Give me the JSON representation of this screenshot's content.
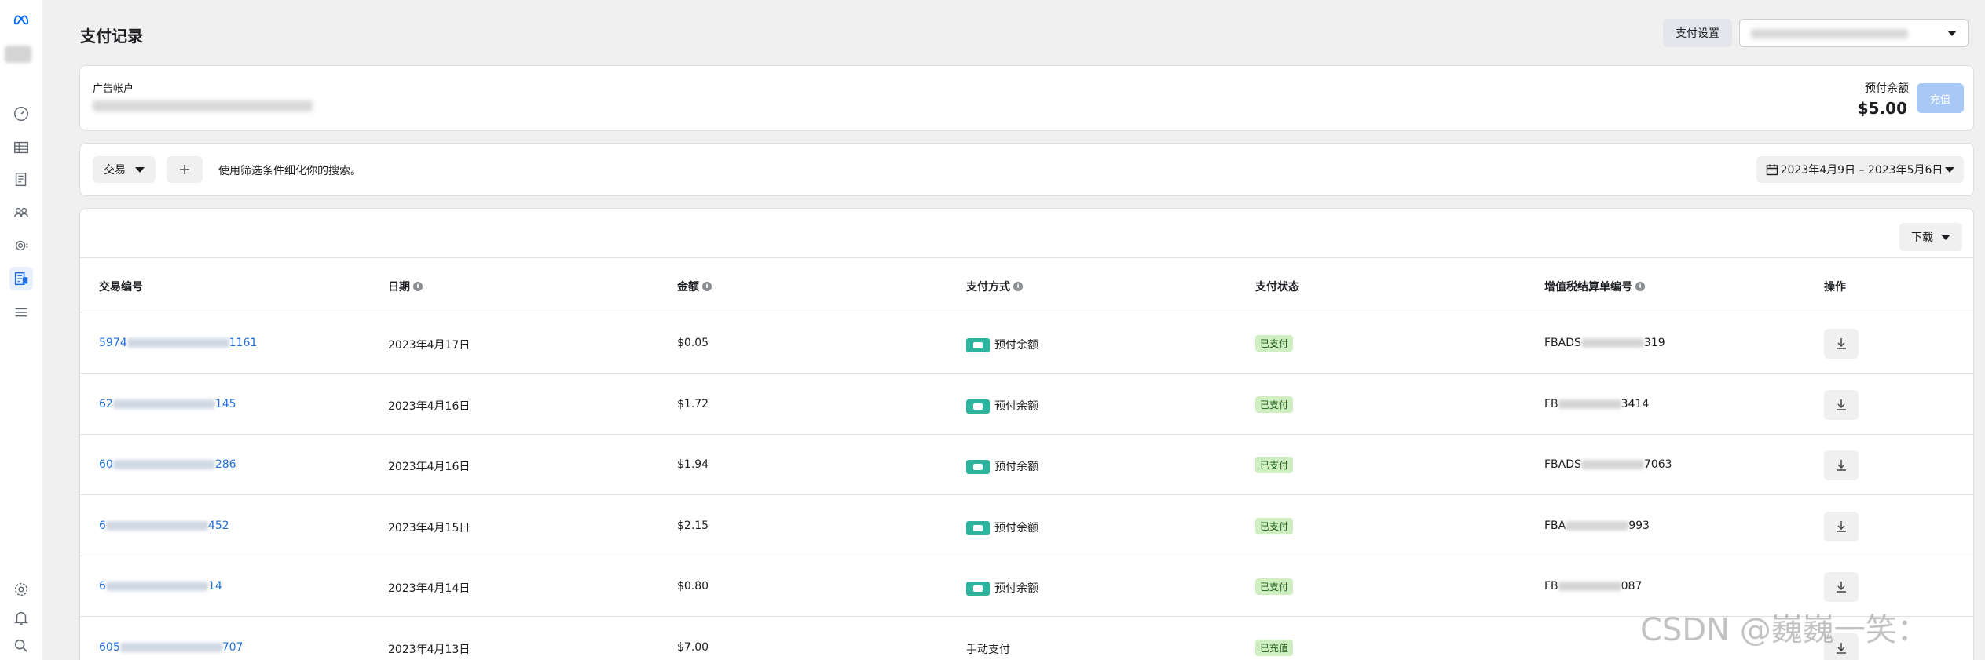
{
  "header": {
    "title": "支付记录",
    "payment_settings_label": "支付设置"
  },
  "account_card": {
    "label": "广告帐户",
    "balance_label": "预付余额",
    "balance_value": "$5.00",
    "topup_label": "充值"
  },
  "filter_bar": {
    "filter_label": "交易",
    "add_icon": "plus-icon",
    "hint": "使用筛选条件细化你的搜索。",
    "date_range": "2023年4月9日 – 2023年5月6日"
  },
  "table": {
    "download_label": "下载",
    "columns": [
      "交易编号",
      "日期",
      "金额",
      "支付方式",
      "支付状态",
      "增值税结算单编号",
      "操作"
    ],
    "rows": [
      {
        "id_prefix": "5974",
        "id_suffix": "1161",
        "date": "2023年4月17日",
        "amount": "$0.05",
        "method": "预付余额",
        "status": "已支付",
        "vat_prefix": "FBADS",
        "vat_suffix": "319"
      },
      {
        "id_prefix": "62",
        "id_suffix": "145",
        "date": "2023年4月16日",
        "amount": "$1.72",
        "method": "预付余额",
        "status": "已支付",
        "vat_prefix": "FB",
        "vat_suffix": "3414"
      },
      {
        "id_prefix": "60",
        "id_suffix": "286",
        "date": "2023年4月16日",
        "amount": "$1.94",
        "method": "预付余额",
        "status": "已支付",
        "vat_prefix": "FBADS",
        "vat_suffix": "7063"
      },
      {
        "id_prefix": "6",
        "id_suffix": "452",
        "date": "2023年4月15日",
        "amount": "$2.15",
        "method": "预付余额",
        "status": "已支付",
        "vat_prefix": "FBA",
        "vat_suffix": "993"
      },
      {
        "id_prefix": "6",
        "id_suffix": "14",
        "date": "2023年4月14日",
        "amount": "$0.80",
        "method": "预付余额",
        "status": "已支付",
        "vat_prefix": "FB",
        "vat_suffix": "087"
      },
      {
        "id_prefix": "605",
        "id_suffix": "707",
        "date": "2023年4月13日",
        "amount": "$7.00",
        "method": "手动支付",
        "status": "已充值",
        "vat_prefix": "",
        "vat_suffix": ""
      }
    ]
  },
  "watermark": "CSDN @巍巍一笑：",
  "colors": {
    "link": "#216fdb",
    "status_green_bg": "#cfeec2",
    "pay_icon": "#2db39e",
    "topup_disabled": "#a8c9f5"
  }
}
